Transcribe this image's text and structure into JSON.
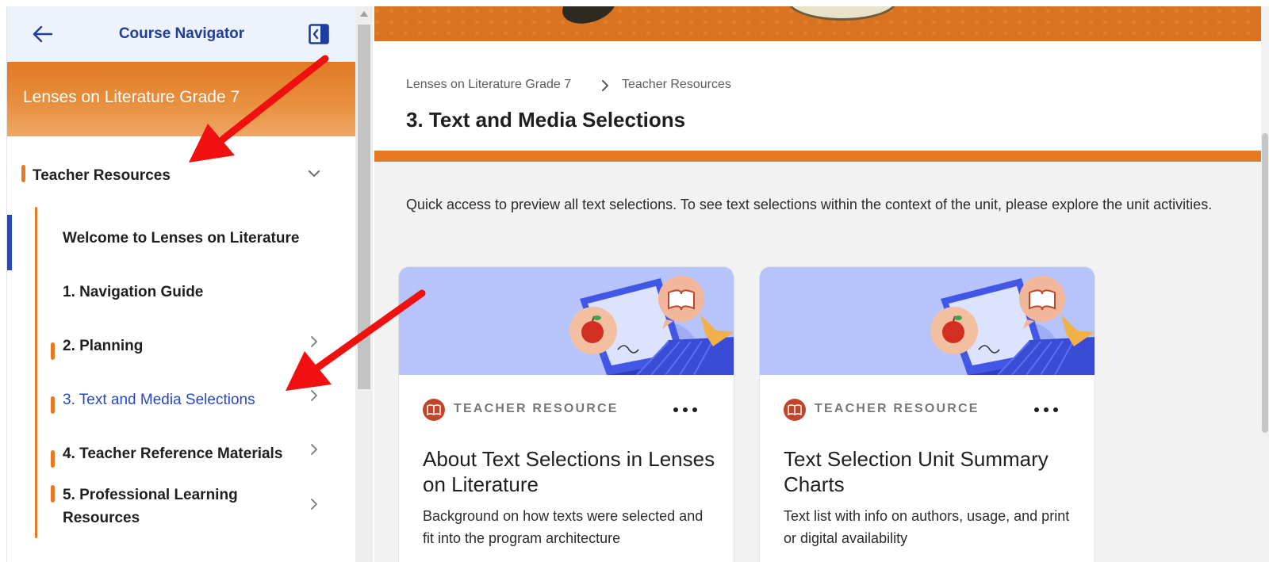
{
  "sidebar": {
    "title": "Course Navigator",
    "back_icon": "arrow-left-icon",
    "collapse_icon": "collapse-panel-icon",
    "course_title": "Lenses on Literature Grade 7",
    "section": {
      "label": "Teacher Resources",
      "expanded": true
    },
    "items": [
      {
        "label": "Welcome to Lenses on Literature",
        "has_children": false
      },
      {
        "label": "1. Navigation Guide",
        "has_children": false
      },
      {
        "label": "2. Planning",
        "has_children": true
      },
      {
        "label": "3. Text and Media Selections",
        "has_children": true,
        "current": true
      },
      {
        "label": "4. Teacher Reference Materials",
        "has_children": true
      },
      {
        "label": "5. Professional Learning",
        "label_line2": "Resources",
        "has_children": true
      }
    ]
  },
  "main": {
    "breadcrumb": [
      "Lenses on Literature Grade 7",
      "Teacher Resources"
    ],
    "page_title": "3. Text and Media Selections",
    "intro": "Quick access to preview all text selections. To see text selections within the context of the unit, please explore the unit activities.",
    "cards": [
      {
        "type": "TEACHER RESOURCE",
        "title": "About Text Selections in Lenses on Literature",
        "description": "Background on how texts were selected and fit into the program architecture"
      },
      {
        "type": "TEACHER RESOURCE",
        "title": "Text Selection Unit Summary Charts",
        "description": "Text list with info on authors, usage, and print or digital availability"
      }
    ]
  },
  "colors": {
    "brand_orange": "#e67a22",
    "nav_blue": "#1d3e9c",
    "active_blue": "#2947c4",
    "card_art": "#b7c3fb",
    "badge_red": "#c0462b",
    "annotation_red": "#f01010"
  }
}
